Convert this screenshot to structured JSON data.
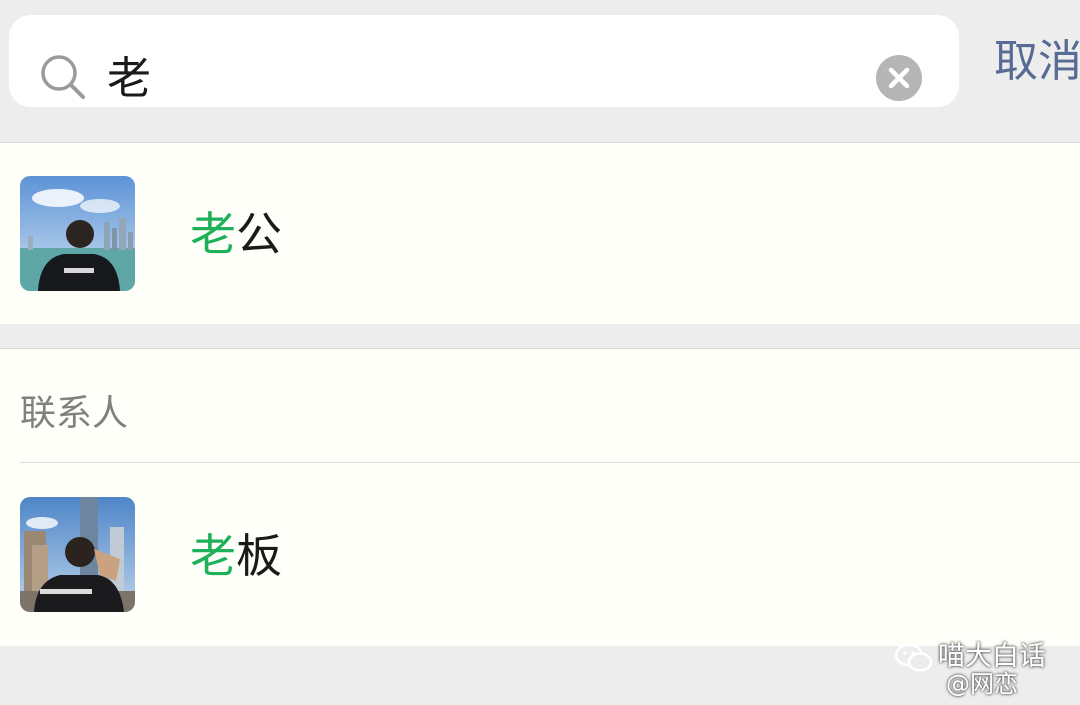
{
  "search": {
    "query": "老",
    "cancel_label": "取消"
  },
  "top_result": {
    "name_highlight": "老",
    "name_rest": "公"
  },
  "contacts": {
    "header": "联系人",
    "items": [
      {
        "name_highlight": "老",
        "name_rest": "板"
      }
    ]
  },
  "watermark": {
    "account": "喵大白话",
    "handle": "@网恋"
  },
  "colors": {
    "highlight": "#1fb05a",
    "cancel": "#586b95",
    "background": "#ededed"
  },
  "icons": [
    "search-icon",
    "clear-icon",
    "wechat-logo-icon",
    "weibo-logo-icon"
  ]
}
